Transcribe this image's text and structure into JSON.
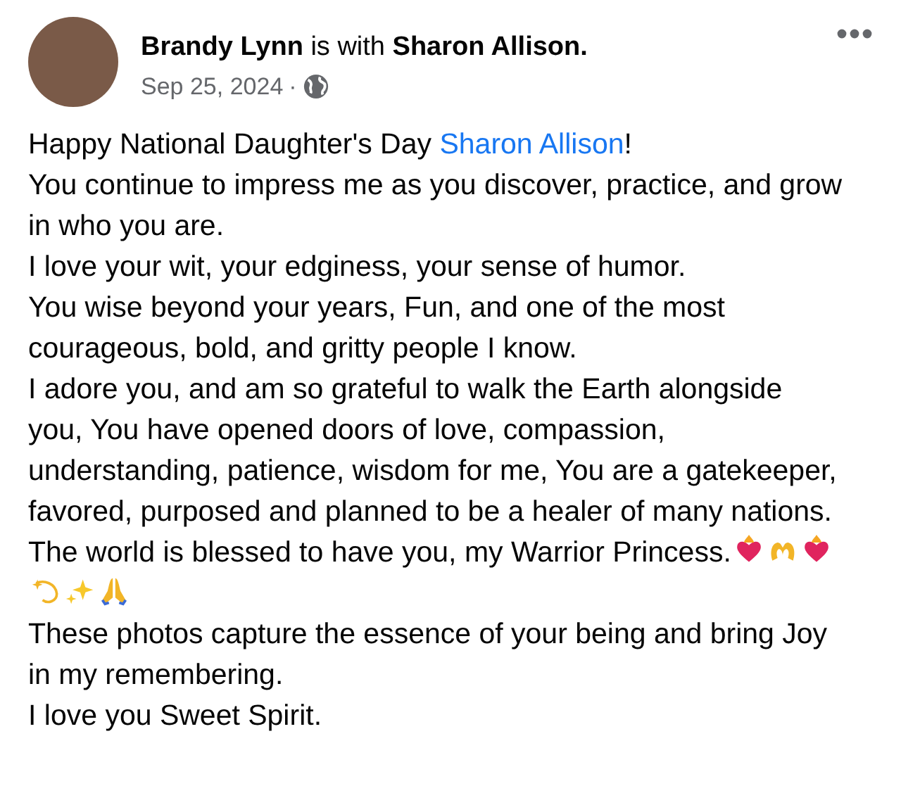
{
  "post": {
    "author": "Brandy Lynn",
    "with_text": "is with",
    "tagged": "Sharon Allison.",
    "date": "Sep 25, 2024",
    "separator": "·",
    "paragraphs": [
      {
        "parts": [
          {
            "kind": "text",
            "text": "Happy National Daughter's Day "
          },
          {
            "kind": "mention",
            "text": "Sharon Allison"
          },
          {
            "kind": "text",
            "text": "!"
          }
        ]
      },
      {
        "parts": [
          {
            "kind": "text",
            "text": "You continue to impress me as you discover, practice, and grow in who you are."
          }
        ]
      },
      {
        "parts": [
          {
            "kind": "text",
            "text": "I love your wit, your edginess, your sense of humor."
          }
        ]
      },
      {
        "parts": [
          {
            "kind": "text",
            "text": "You wise beyond your years, Fun, and one of the most courageous, bold, and gritty people I know."
          }
        ]
      },
      {
        "parts": [
          {
            "kind": "text",
            "text": "I adore you, and am so grateful to walk the Earth alongside you, You have opened doors of love, compassion, understanding, patience, wisdom for me, You are a gatekeeper, favored, purposed and planned to be a healer of many nations."
          }
        ]
      },
      {
        "parts": [
          {
            "kind": "text",
            "text": "The world is blessed to have you, my Warrior Princess."
          },
          {
            "kind": "emoji_row"
          }
        ]
      },
      {
        "parts": [
          {
            "kind": "text",
            "text": "These photos capture the essence of your being and bring Joy in my remembering."
          }
        ]
      },
      {
        "parts": [
          {
            "kind": "text",
            "text": "I love you Sweet Spirit."
          }
        ]
      }
    ]
  }
}
